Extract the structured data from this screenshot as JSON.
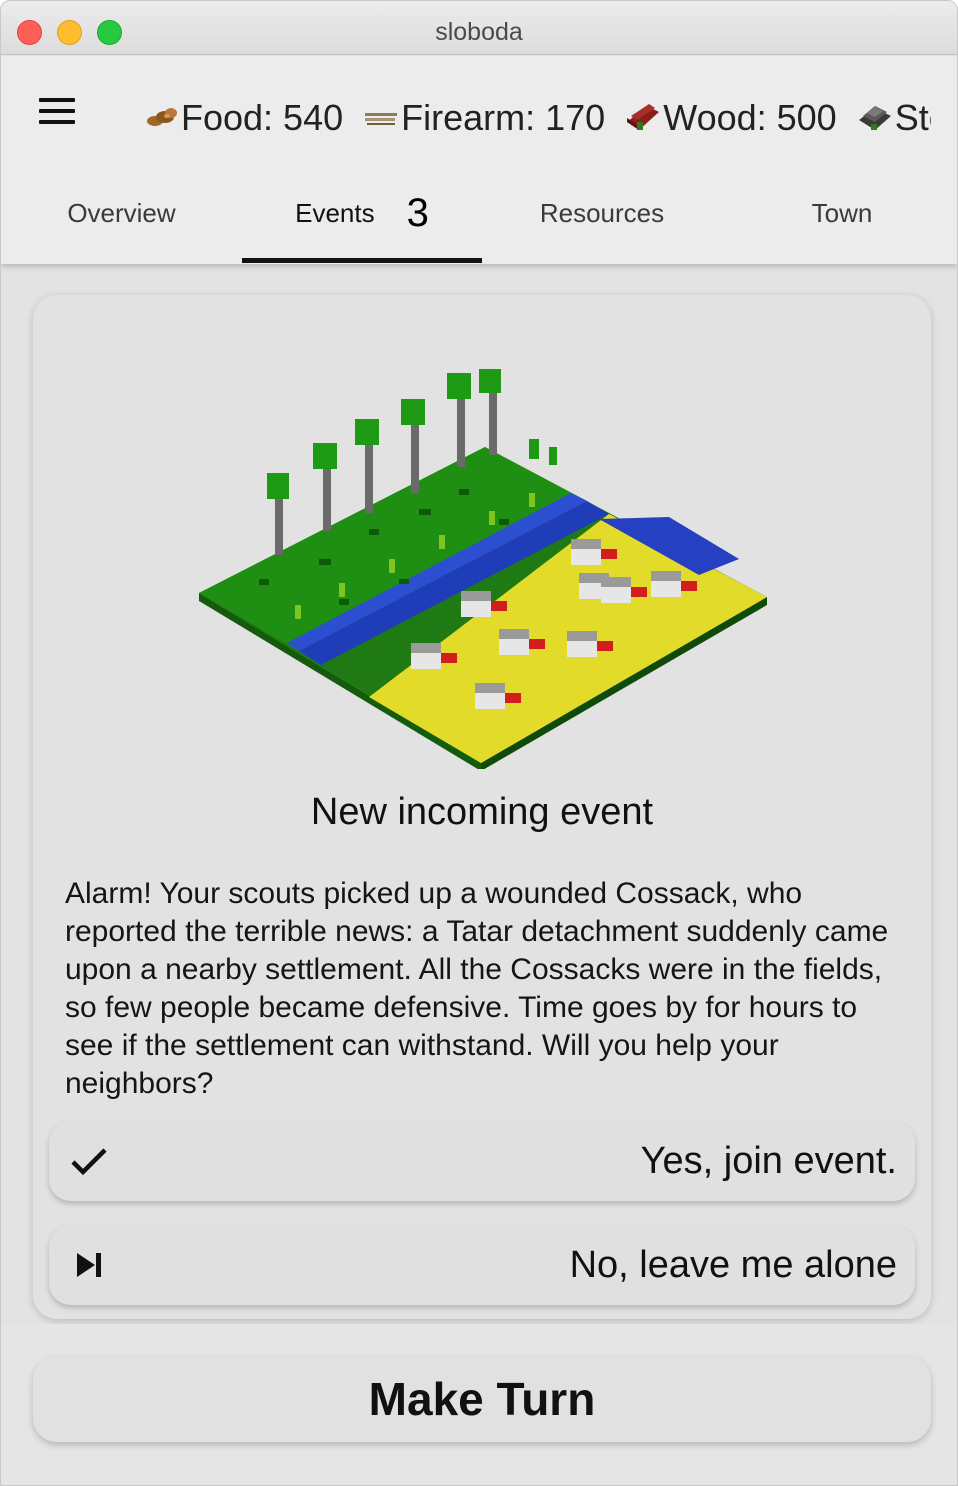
{
  "window": {
    "title": "sloboda"
  },
  "resources": [
    {
      "icon": "food-icon",
      "label": "Food: 540"
    },
    {
      "icon": "firearm-icon",
      "label": "Firearm: 170"
    },
    {
      "icon": "wood-icon",
      "label": "Wood: 500"
    },
    {
      "icon": "stone-icon",
      "label": "Stone"
    }
  ],
  "tabs": [
    {
      "label": "Overview"
    },
    {
      "label": "Events",
      "badge": "3"
    },
    {
      "label": "Resources"
    },
    {
      "label": "Town"
    }
  ],
  "event": {
    "title": "New incoming event",
    "description": "Alarm! Your scouts picked up a wounded Cossack, who reported the terrible news: a Tatar detachment suddenly came upon a nearby settlement. All the Cossacks were in the fields, so few people became defensive. Time goes by for hours to see if the settlement can withstand. Will you help your neighbors?",
    "choices": [
      {
        "icon": "check-icon",
        "label": "Yes, join event."
      },
      {
        "icon": "skip-next-icon",
        "label": "No, leave me alone"
      }
    ]
  },
  "make_turn_label": "Make Turn"
}
